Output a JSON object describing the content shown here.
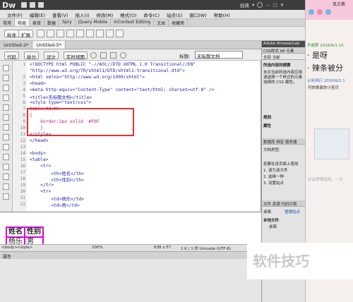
{
  "app": {
    "logo": "Dw",
    "workspace": "经典",
    "window_controls": [
      "－",
      "□",
      "✕"
    ]
  },
  "menu": [
    "文件(F)",
    "编辑(E)",
    "查看(V)",
    "插入(I)",
    "修改(M)",
    "格式(O)",
    "命令(C)",
    "站点(S)",
    "窗口(W)",
    "帮助(H)"
  ],
  "insert_categories": [
    {
      "label": "常用",
      "active": false
    },
    {
      "label": "布局",
      "active": true
    },
    {
      "label": "表单",
      "active": false
    },
    {
      "label": "数据",
      "active": false
    },
    {
      "label": "Spry",
      "active": false
    },
    {
      "label": "jQuery Mobile",
      "active": false
    },
    {
      "label": "InContext Editing",
      "active": false
    },
    {
      "label": "文本",
      "active": false
    },
    {
      "label": "收藏夹",
      "active": false
    }
  ],
  "insertbar": {
    "standard_btn": "标准",
    "expand_btn": "扩展"
  },
  "doc_tabs": [
    {
      "label": "Untitled-2*",
      "active": false
    },
    {
      "label": "Untitled-5*",
      "active": true
    }
  ],
  "views": {
    "code": "代码",
    "split": "拆分",
    "design": "设计",
    "live": "实时视图",
    "title_label": "标题:",
    "title_value": "无标题文档"
  },
  "code_lines": [
    {
      "num": "1",
      "text": "<!DOCTYPE html PUBLIC \"-//W3C//DTD XHTML 1.0 Transitional//EN\"",
      "kind": "tag"
    },
    {
      "num": "",
      "text": "\"http://www.w3.org/TR/xhtml1/DTD/xhtml1-transitional.dtd\">",
      "kind": "tag"
    },
    {
      "num": "2",
      "text": "<html xmlns=\"http://www.w3.org/1999/xhtml\">",
      "kind": "tag"
    },
    {
      "num": "3",
      "text": "<head>",
      "kind": "tag"
    },
    {
      "num": "4",
      "text": "<meta http-equiv=\"Content-Type\" content=\"text/html; charset=utf-8\" />",
      "kind": "tag"
    },
    {
      "num": "5",
      "text": "<title>无标题文档</title>",
      "kind": "tag"
    },
    {
      "num": "6",
      "text": "<style type=\"text/css\">",
      "kind": "tag"
    },
    {
      "num": "7",
      "text": "table,td,th",
      "kind": "css"
    },
    {
      "num": "8",
      "text": "{",
      "kind": "css"
    },
    {
      "num": "9",
      "text": "    border:2px solid  #F0F",
      "kind": "css"
    },
    {
      "num": "10",
      "text": "    }",
      "kind": "css"
    },
    {
      "num": "11",
      "text": "</style>",
      "kind": "tag"
    },
    {
      "num": "12",
      "text": "</head>",
      "kind": "tag"
    },
    {
      "num": "13",
      "text": "",
      "kind": "tag"
    },
    {
      "num": "14",
      "text": "<body>",
      "kind": "tag"
    },
    {
      "num": "15",
      "text": "<table>",
      "kind": "tag"
    },
    {
      "num": "16",
      "text": "    <tr>",
      "kind": "tag"
    },
    {
      "num": "17",
      "text": "        <th>姓名</th>",
      "kind": "tag"
    },
    {
      "num": "18",
      "text": "        <th>性别</th>",
      "kind": "tag"
    },
    {
      "num": "19",
      "text": "    </tr>",
      "kind": "tag"
    },
    {
      "num": "20",
      "text": "    <tr>",
      "kind": "tag"
    },
    {
      "num": "21",
      "text": "        <td>杨乐</td>",
      "kind": "tag"
    },
    {
      "num": "22",
      "text": "        <td>男</td>",
      "kind": "tag"
    }
  ],
  "design_table": [
    [
      "姓名",
      "性别"
    ],
    [
      "杨乐",
      "男"
    ]
  ],
  "status": {
    "tags": [
      "<body>",
      "<style>"
    ],
    "zoom": "100%",
    "size": "638 x 57",
    "info": "1 K / 1 秒 Unicode (UTF-8)"
  },
  "props": {
    "title": "属性"
  },
  "right_panel": {
    "top": "Adobe BrowserLab",
    "css_tabs": [
      "CSS样式",
      "AP 元素"
    ],
    "css_modes": [
      "全部",
      "当前"
    ],
    "summary_title": "所选内容的摘要",
    "summary_text": [
      "未对当前所选内容应用",
      "请选择一个样式的元素",
      "选择的 CSS 属性。"
    ],
    "rules": "规则",
    "attrs": "属性",
    "db_tabs": [
      "数据库",
      "绑定",
      "服务器"
    ],
    "doc_type": "文档类型:",
    "steps": [
      "若要在该页面上使用",
      "1. 请为该文件",
      "2. 选择一种",
      "3. 设置站点"
    ],
    "file_tabs": [
      "文件",
      "资源",
      "代码片断"
    ],
    "desktop": "桌面",
    "manage": "管理站点",
    "local": "本地文件",
    "desktop2": "桌面"
  },
  "chat": {
    "name": "真正教",
    "msg1_meta": "不谢梦 2016/6/1 15",
    "msg1_lines": [
      "· 是呀",
      "· 辣条被分"
    ],
    "msg2_meta": "止听风行 2016/6/1 1",
    "msg2_text": "可你表家的小宝贝",
    "input_hint": "好品质嘴选择，一点"
  },
  "watermark": "软件技巧"
}
